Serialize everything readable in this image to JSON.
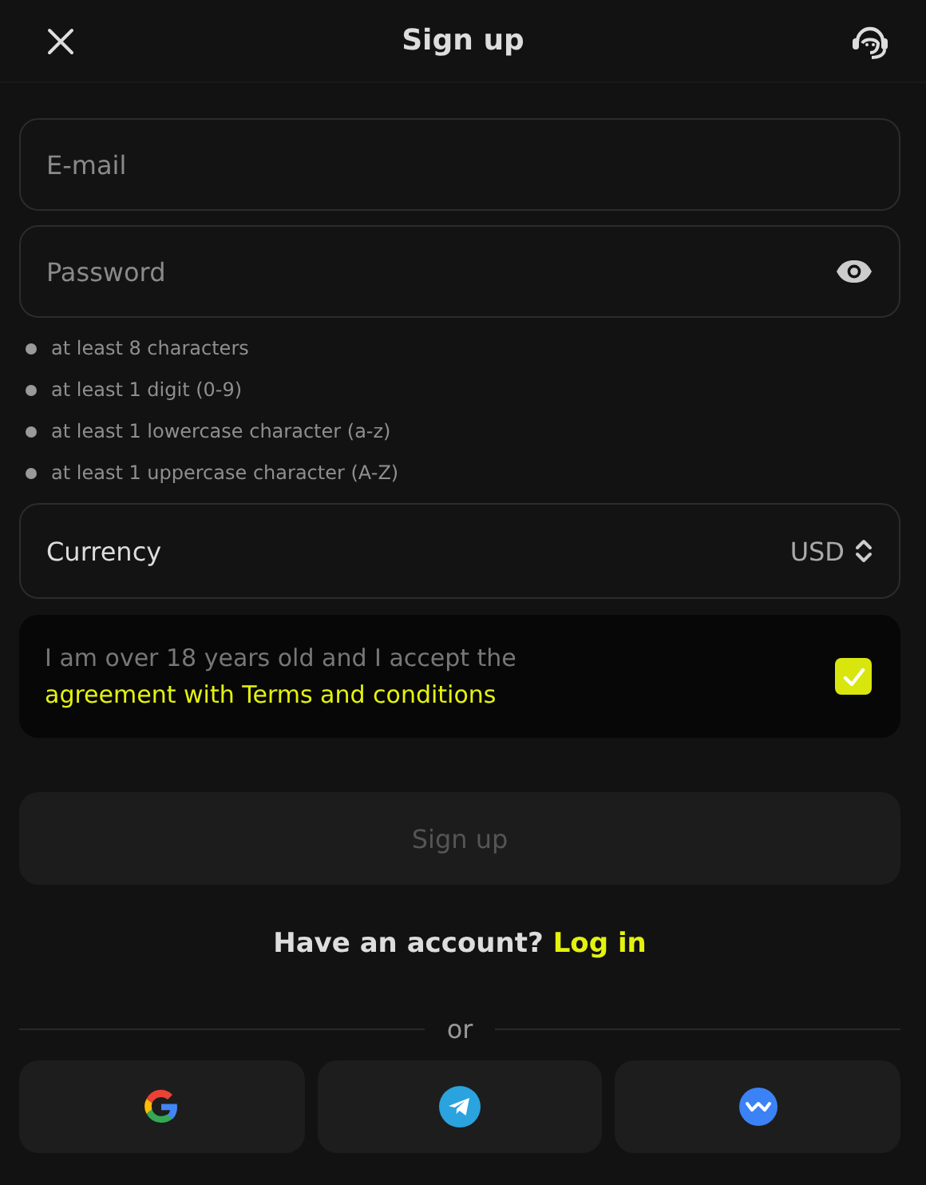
{
  "header": {
    "title": "Sign up"
  },
  "fields": [
    {
      "kind": "text",
      "placeholder": "E-mail"
    },
    {
      "kind": "password",
      "placeholder": "Password"
    }
  ],
  "password_rules": [
    "at least 8 characters",
    "at least 1 digit (0-9)",
    "at least 1 lowercase character (a-z)",
    "at least 1 uppercase character (A-Z)"
  ],
  "currency": {
    "label": "Currency",
    "value": "USD"
  },
  "terms": {
    "text": "I am over 18 years old and I accept the ",
    "link": "agreement with Terms and conditions",
    "checked": true
  },
  "submit": {
    "label": "Sign up",
    "disabled": true
  },
  "login": {
    "text": "Have an account?",
    "link": "Log in"
  },
  "divider": "or",
  "social": [
    {
      "kind": "google"
    },
    {
      "kind": "telegram"
    },
    {
      "kind": "wave"
    }
  ]
}
